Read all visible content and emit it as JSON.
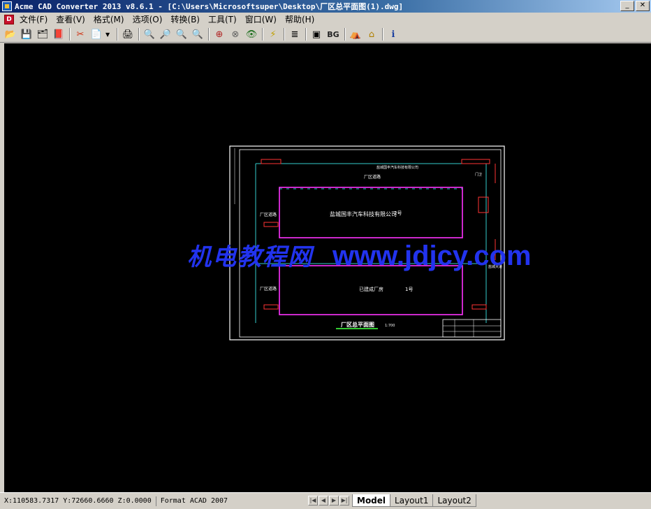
{
  "window": {
    "title": "Acme CAD Converter 2013 v8.6.1 - [C:\\Users\\Microsoftsuper\\Desktop\\厂区总平面图(1).dwg]",
    "buttons": [
      "_",
      "✕"
    ]
  },
  "menu": {
    "items": [
      "文件(F)",
      "查看(V)",
      "格式(M)",
      "选项(O)",
      "转换(B)",
      "工具(T)",
      "窗口(W)",
      "帮助(H)"
    ]
  },
  "toolbar": {
    "items": [
      {
        "name": "open-icon",
        "glyph": "📂"
      },
      {
        "name": "save-icon",
        "glyph": "💾"
      },
      {
        "name": "save-all-icon",
        "glyph": "🗂"
      },
      {
        "name": "export-icon",
        "glyph": "📕"
      },
      {
        "name": "convert-icon",
        "glyph": "✂"
      },
      {
        "name": "batch-icon",
        "glyph": "📄"
      },
      {
        "name": "print-icon",
        "glyph": "🖨"
      },
      {
        "name": "zoom-in-icon",
        "glyph": "🔍"
      },
      {
        "name": "zoom-out-icon",
        "glyph": "🔎"
      },
      {
        "name": "zoom-window-icon",
        "glyph": "🔍"
      },
      {
        "name": "zoom-extents-icon",
        "glyph": "🔍"
      },
      {
        "name": "zoom-realtime-icon",
        "glyph": "⊕"
      },
      {
        "name": "pan-icon",
        "glyph": "⊗"
      },
      {
        "name": "view-icon",
        "glyph": "👁"
      },
      {
        "name": "lightning-icon",
        "glyph": "⚡"
      },
      {
        "name": "layers-icon",
        "glyph": "≣"
      },
      {
        "name": "properties-icon",
        "glyph": "▣"
      },
      {
        "name": "background-button",
        "glyph": "BG"
      },
      {
        "name": "web-icon",
        "glyph": "⛺"
      },
      {
        "name": "home-icon",
        "glyph": "⌂"
      },
      {
        "name": "info-icon",
        "glyph": "ℹ"
      }
    ]
  },
  "drawing": {
    "company_top": "盐城国丰汽车科技有限公司",
    "area_1": "厂区道路",
    "main_building_label": "盐城国丰汽车科技有限公司",
    "main_building_no": "2号",
    "lower_building_label": "已建成厂房",
    "lower_building_no": "1号",
    "road_left_1": "厂区道路",
    "road_left_2": "厂区道路",
    "gate_label": "门卫",
    "right_label": "盐城大道",
    "plan_title": "厂区总平面图",
    "scale_text": "1:700"
  },
  "watermark": {
    "cn": "机电教程网",
    "url": "www.jdjcy.com"
  },
  "status": {
    "coords": "X:110583.7317 Y:72660.6660 Z:0.0000",
    "format": "Format ACAD 2007"
  },
  "nav": [
    "|◀",
    "◀",
    "▶",
    "▶|"
  ],
  "tabs": [
    "Model",
    "Layout1",
    "Layout2"
  ],
  "colors": {
    "canvas_bg": "#000000",
    "building_outline": "#ff33ff",
    "road_line": "#33cccc",
    "markers": "#ff3333",
    "watermark": "#2233ee"
  }
}
